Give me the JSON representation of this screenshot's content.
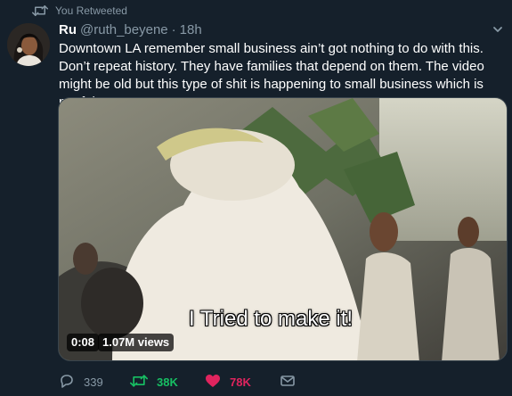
{
  "retweet_context": {
    "label": "You Retweeted",
    "icon": "retweet-icon"
  },
  "tweet": {
    "display_name": "Ru",
    "handle": "@ruth_beyene",
    "separator": "·",
    "time": "18h",
    "text": "Downtown LA remember small business ain’t got nothing to do with this. Don’t repeat history. They have families that depend on them. The video might be old but this type of shit is happening to small business which is not fair"
  },
  "video": {
    "subtitle": "I Tried to make it!",
    "duration": "0:08",
    "views": "1.07M views"
  },
  "actions": {
    "replies": "339",
    "retweets": "38K",
    "likes": "78K"
  },
  "colors": {
    "background": "#15202b",
    "secondary_text": "#8899a6",
    "retweet_active": "#17bf63",
    "like_active": "#e0245e"
  }
}
